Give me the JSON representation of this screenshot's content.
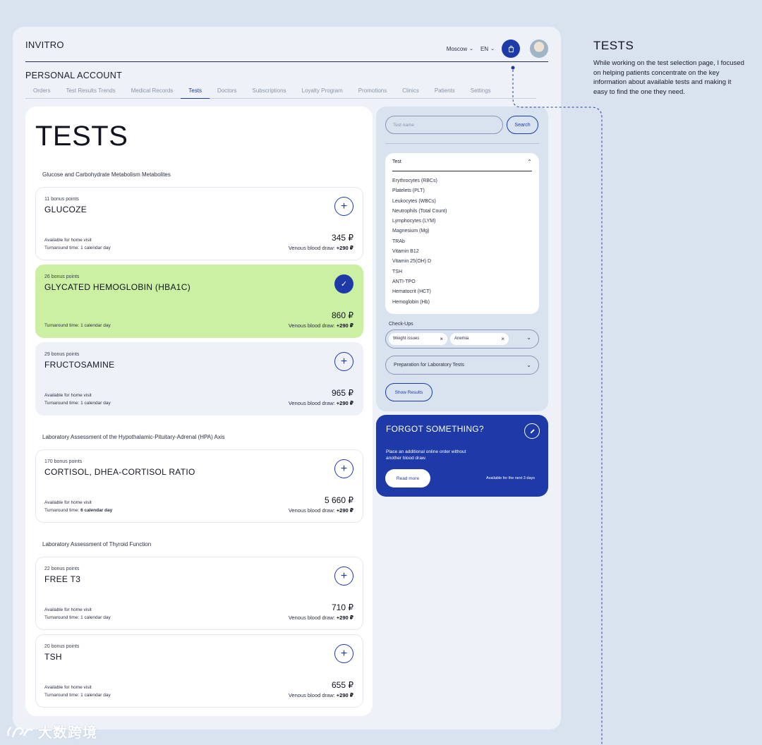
{
  "header": {
    "logo": "INVITRO",
    "city": "Moscow",
    "language": "EN"
  },
  "account_title": "PERSONAL ACCOUNT",
  "tabs": [
    {
      "label": "Orders"
    },
    {
      "label": "Test Results Trends"
    },
    {
      "label": "Medical Records"
    },
    {
      "label": "Tests"
    },
    {
      "label": "Doctors"
    },
    {
      "label": "Subscriptions"
    },
    {
      "label": "Loyalty Program"
    },
    {
      "label": "Promotions"
    },
    {
      "label": "Clinics"
    },
    {
      "label": "Patients"
    },
    {
      "label": "Settings"
    }
  ],
  "page_title": "TESTS",
  "sections": [
    {
      "label": "Glucose and Carbohydrate Metabolism Metabolites"
    },
    {
      "label": "Laboratory Assessment of the Hypothalamic-Pituitary-Adrenal (HPA) Axis"
    },
    {
      "label": "Laboratory Assessment of Thyroid Function"
    }
  ],
  "cards": [
    {
      "bonus": "11 bonus points",
      "name": "GLUCOZE",
      "home": "Available for home visit",
      "turn_prefix": "Turnaround time: ",
      "turn_days": "1 calendar day",
      "price": "345 ₽",
      "draw_label": "Venous blood draw: ",
      "draw_price": "+290 ₽"
    },
    {
      "bonus": "26 bonus points",
      "name": "GLYCATED HEMOGLOBIN (HBA1C)",
      "home": "",
      "turn_prefix": "Turnaround time: ",
      "turn_days": "1 calendar day",
      "price": "860 ₽",
      "draw_label": "Venous blood draw: ",
      "draw_price": "+290 ₽"
    },
    {
      "bonus": "29 bonus points",
      "name": "FRUCTOSAMINE",
      "home": "Available for home visit",
      "turn_prefix": "Turnaround time: ",
      "turn_days": "1 calendar day",
      "price": "965 ₽",
      "draw_label": "Venous blood draw: ",
      "draw_price": "+290 ₽"
    },
    {
      "bonus": "170 bonus points",
      "name": "CORTISOL, DHEA-CORTISOL RATIO",
      "home": "Available for home visit",
      "turn_prefix": "Turnaround time: ",
      "turn_days": "6 calendar day",
      "price": "5 660 ₽",
      "draw_label": "Venous blood draw: ",
      "draw_price": "+290 ₽"
    },
    {
      "bonus": "22 bonus points",
      "name": "FREE T3",
      "home": "Available for home visit",
      "turn_prefix": "Turnaround time: ",
      "turn_days": "1 calendar day",
      "price": "710 ₽",
      "draw_label": "Venous blood draw: ",
      "draw_price": "+290 ₽"
    },
    {
      "bonus": "20 bonus points",
      "name": "TSH",
      "home": "Available for home visit",
      "turn_prefix": "Turnaround time: ",
      "turn_days": "1 calendar day",
      "price": "655 ₽",
      "draw_label": "Venous blood draw: ",
      "draw_price": "+290 ₽"
    }
  ],
  "filters": {
    "search_placeholder": "Test name",
    "search_button": "Search",
    "test_dropdown_label": "Test",
    "tests": [
      "Erythrocytes (RBCs)",
      "Platelets (PLT)",
      "Leukocytes (WBCs)",
      "Neutrophils (Total Count)",
      "Lymphocytes (LYM)",
      "Magnesium (Mg)",
      "TRAb",
      "Vitamin B12",
      "Vitamin 25(OH) D",
      "TSH",
      "ANTI-TPO",
      "Hematocrit (HCT)",
      "Hemoglobin (Hb)"
    ],
    "checkups_label": "Check-Ups",
    "checkups_chips": [
      "Weight issues",
      "Anemia"
    ],
    "preparation_label": "Preparation for Laboratory Tests",
    "show_results": "Show Results"
  },
  "promo": {
    "title": "FORGOT SOMETHING?",
    "description": "Place an additional online order without another blood draw.",
    "button": "Read more",
    "availability": "Available for the next 3 days"
  },
  "annotation": {
    "title": "TESTS",
    "text": "While working on the test selection page, I focused on helping patients concentrate on the key information about available tests and making it easy to find the one they need."
  },
  "watermark": "大数跨境",
  "colors": {
    "accent": "#1e3aa8",
    "selected_card": "#cbf0a2",
    "background": "#d9e3ef",
    "panel": "#eef2f8"
  },
  "icons": {
    "cart": "shopping-bag-icon",
    "add": "plus-icon",
    "selected": "check-icon",
    "expand": "chevron-down-icon",
    "collapse": "chevron-up-icon",
    "remove": "close-icon",
    "edit": "pencil-icon"
  }
}
